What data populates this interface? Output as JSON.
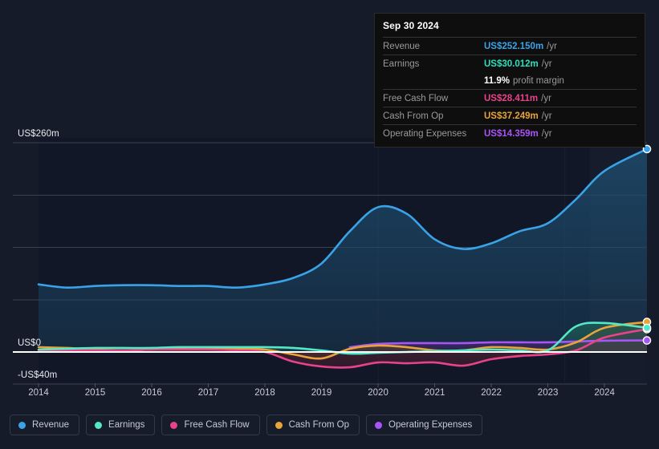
{
  "tooltip": {
    "date": "Sep 30 2024",
    "rows": [
      {
        "key": "Revenue",
        "value": "US$252.150m",
        "unit": "/yr",
        "color": "#3aa3e8",
        "sub": ""
      },
      {
        "key": "Earnings",
        "value": "US$30.012m",
        "unit": "/yr",
        "color": "#2ee0bd",
        "sub": ""
      },
      {
        "key": "",
        "value": "11.9%",
        "unit": "",
        "color": "#ffffff",
        "sub": "profit margin"
      },
      {
        "key": "Free Cash Flow",
        "value": "US$28.411m",
        "unit": "/yr",
        "color": "#e8438a",
        "sub": ""
      },
      {
        "key": "Cash From Op",
        "value": "US$37.249m",
        "unit": "/yr",
        "color": "#e8a33a",
        "sub": ""
      },
      {
        "key": "Operating Expenses",
        "value": "US$14.359m",
        "unit": "/yr",
        "color": "#a855f7",
        "sub": ""
      }
    ]
  },
  "legend": {
    "items": [
      {
        "label": "Revenue",
        "color": "#3aa3e8"
      },
      {
        "label": "Earnings",
        "color": "#54e8c4"
      },
      {
        "label": "Free Cash Flow",
        "color": "#e8438a"
      },
      {
        "label": "Cash From Op",
        "color": "#e8a33a"
      },
      {
        "label": "Operating Expenses",
        "color": "#a855f7"
      }
    ]
  },
  "chart_data": {
    "type": "area",
    "title": "",
    "xlabel": "",
    "ylabel": "",
    "grid": true,
    "legend_position": "bottom",
    "ylim": [
      -40,
      260
    ],
    "y_ticks": [
      260,
      0,
      -40
    ],
    "y_tick_labels": [
      "US$260m",
      "US$0",
      "-US$40m"
    ],
    "gridline_values": [
      260,
      195,
      130,
      65,
      0,
      -40
    ],
    "x": [
      2014,
      2014.5,
      2015,
      2015.5,
      2016,
      2016.5,
      2017,
      2017.5,
      2018,
      2018.5,
      2019,
      2019.5,
      2020,
      2020.5,
      2021,
      2021.5,
      2022,
      2022.5,
      2023,
      2023.5,
      2024,
      2024.75
    ],
    "x_ticks": [
      2014,
      2015,
      2016,
      2017,
      2018,
      2019,
      2020,
      2021,
      2022,
      2023,
      2024
    ],
    "x_tick_labels": [
      "2014",
      "2015",
      "2016",
      "2017",
      "2018",
      "2019",
      "2020",
      "2021",
      "2022",
      "2023",
      "2024"
    ],
    "series": [
      {
        "name": "Revenue",
        "color": "#3aa3e8",
        "fill": "#1d4a6b",
        "values": [
          84,
          80,
          82,
          83,
          83,
          82,
          82,
          80,
          84,
          92,
          110,
          150,
          180,
          172,
          140,
          128,
          135,
          150,
          160,
          190,
          225,
          252.15
        ]
      },
      {
        "name": "Earnings",
        "color": "#54e8c4",
        "fill": "#1d5c58",
        "values": [
          3,
          4,
          5,
          5,
          5,
          6,
          6,
          6,
          6,
          5,
          2,
          -2,
          -1,
          0,
          1,
          2,
          3,
          2,
          2,
          32,
          36,
          30.012
        ]
      },
      {
        "name": "Free Cash Flow",
        "color": "#e8438a",
        "fill": "#5c2336",
        "values": [
          1,
          2,
          2,
          2,
          3,
          3,
          3,
          2,
          0,
          -12,
          -18,
          -19,
          -13,
          -14,
          -13,
          -17,
          -9,
          -5,
          -3,
          2,
          18,
          28.411
        ]
      },
      {
        "name": "Cash From Op",
        "color": "#e8a33a",
        "fill": "#5c4320",
        "values": [
          6,
          5,
          3,
          2,
          3,
          4,
          4,
          4,
          3,
          -3,
          -8,
          4,
          8,
          6,
          2,
          2,
          6,
          5,
          3,
          12,
          30,
          37.249
        ]
      },
      {
        "name": "Operating Expenses",
        "color": "#a855f7",
        "fill": "#43256b",
        "start_x": 2019.5,
        "values": [
          null,
          null,
          null,
          null,
          null,
          null,
          null,
          null,
          null,
          null,
          null,
          6,
          10,
          11,
          11,
          11,
          12,
          12,
          12,
          13,
          14,
          14.359
        ]
      }
    ]
  }
}
